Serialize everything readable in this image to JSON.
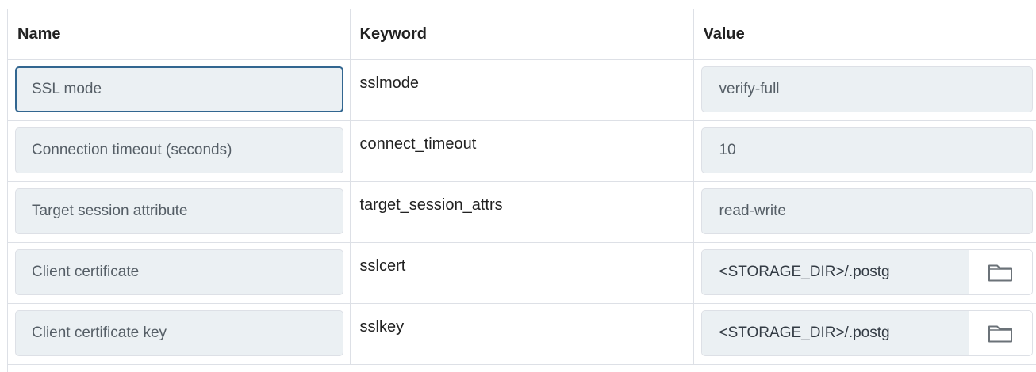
{
  "table": {
    "headers": {
      "name": "Name",
      "keyword": "Keyword",
      "value": "Value"
    },
    "rows": [
      {
        "name": "SSL mode",
        "keyword": "sslmode",
        "value": "verify-full",
        "value_type": "text",
        "focused": true
      },
      {
        "name": "Connection timeout (seconds)",
        "keyword": "connect_timeout",
        "value": "10",
        "value_type": "text"
      },
      {
        "name": "Target session attribute",
        "keyword": "target_session_attrs",
        "value": "read-write",
        "value_type": "text"
      },
      {
        "name": "Client certificate",
        "keyword": "sslcert",
        "value": "<STORAGE_DIR>/.postg",
        "value_type": "file",
        "icon": "folder-icon"
      },
      {
        "name": "Client certificate key",
        "keyword": "sslkey",
        "value": "<STORAGE_DIR>/.postg",
        "value_type": "file",
        "icon": "folder-icon"
      }
    ]
  },
  "colors": {
    "border": "#dde0e6",
    "field_bg": "#ebf0f3",
    "focus_border": "#326690",
    "text_muted": "#555e66"
  }
}
